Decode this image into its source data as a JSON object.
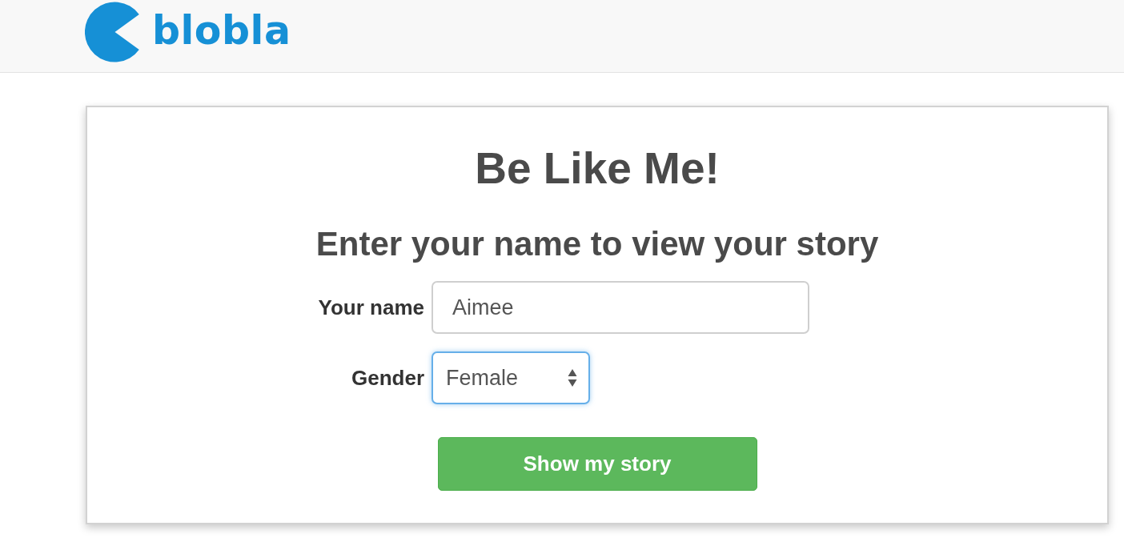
{
  "header": {
    "logo_text": "blobla"
  },
  "card": {
    "title": "Be Like Me!",
    "subtitle": "Enter your name to view your story",
    "fields": [
      {
        "kind": "text",
        "label": "Your name",
        "value": "Aimee",
        "focused": false
      },
      {
        "kind": "select",
        "label": "Gender",
        "value": "Female",
        "focused": true
      }
    ],
    "button": "Show my story"
  }
}
